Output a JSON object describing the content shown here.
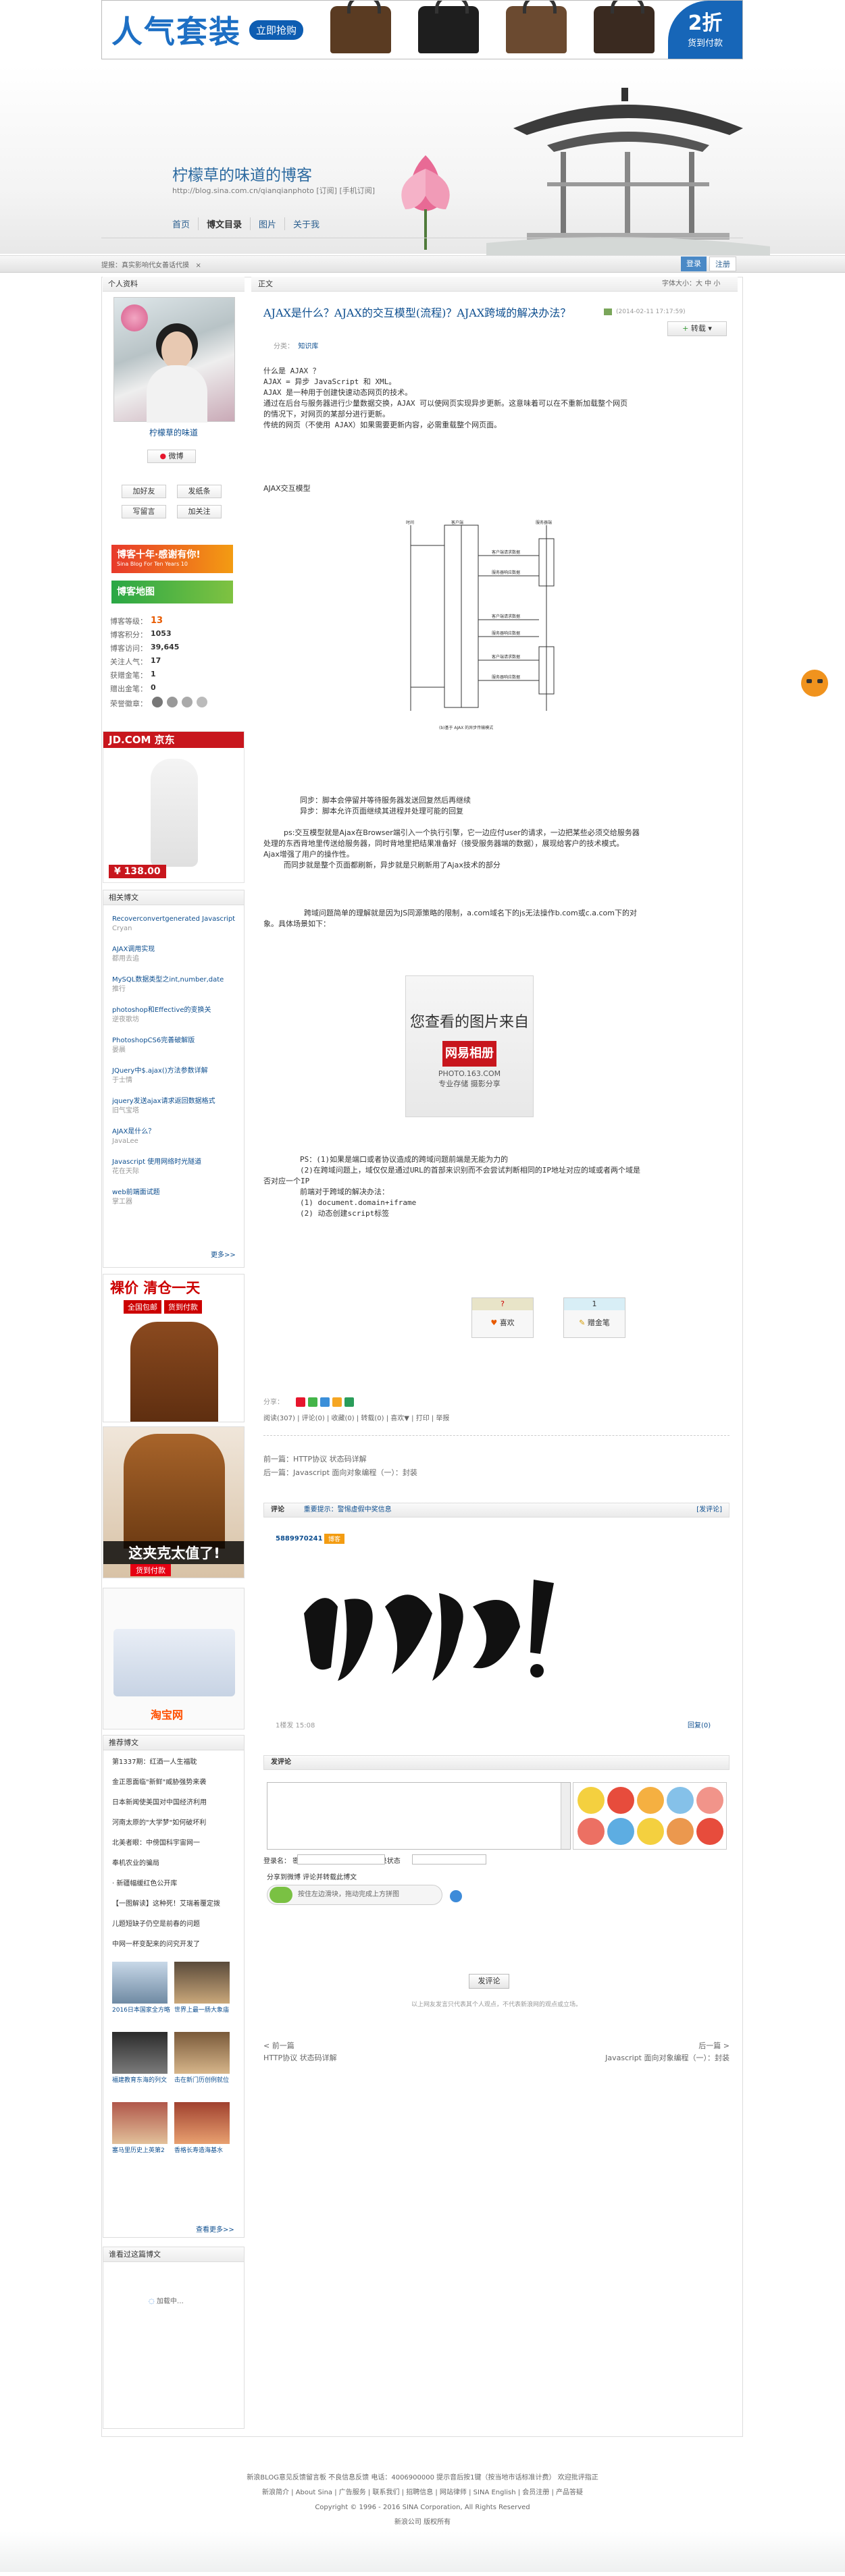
{
  "top_ad": {
    "title": "人气套装",
    "button": "立即抢购",
    "discount": "2折",
    "discount_sub": "货到付款"
  },
  "header": {
    "blog_title": "柠檬草的味道的博客",
    "blog_url": "http://blog.sina.com.cn/qianqianphoto",
    "url_extra": "[订阅] [手机订阅]"
  },
  "nav": [
    "首页",
    "博文目录",
    "图片",
    "关于我"
  ],
  "notice": {
    "text": "提报：真实影响代女善话代摸",
    "close": "×"
  },
  "login": {
    "login": "登录",
    "register": "注册"
  },
  "sidebar": {
    "profile_head": "个人资料",
    "username": "柠檬草的味道",
    "weibo": "微博",
    "buttons": [
      "加好友",
      "发纸条",
      "写留言",
      "加关注"
    ],
    "badge1": "博客十年·感谢有你!",
    "badge1_sub": "Sina Blog For Ten Years 10",
    "badge2": "博客地图",
    "stats": [
      {
        "label": "博客等级：",
        "value": "13"
      },
      {
        "label": "博客积分：",
        "value": "1053"
      },
      {
        "label": "博客访问：",
        "value": "39,645"
      },
      {
        "label": "关注人气：",
        "value": "17"
      },
      {
        "label": "获赠金笔：",
        "value": "1"
      },
      {
        "label": "赠出金笔：",
        "value": "0"
      },
      {
        "label": "荣誉徽章：",
        "value": ""
      }
    ],
    "jd": {
      "brand": "JD.COM 京东",
      "price": "¥ 138.00"
    },
    "related_head": "相关博文",
    "related": [
      {
        "title": "Recoverconvertgenerated Javascript",
        "author": "Cryan"
      },
      {
        "title": "AJAX调用实现",
        "author": "都用去追"
      },
      {
        "title": "MySQL数据类型之int,number,date",
        "author": "推行"
      },
      {
        "title": "photoshop和Effective的变换关",
        "author": "逆夜歌坊"
      },
      {
        "title": "PhotoshopCS6完善破解版",
        "author": "晏晨"
      },
      {
        "title": "JQuery中$.ajax()方法参数详解",
        "author": "于士情"
      },
      {
        "title": "jquery发送ajax请求返回数据格式",
        "author": "旧气宝塔"
      },
      {
        "title": "AJAX是什么？",
        "author": "JavaLee"
      },
      {
        "title": "Javascript 使用网络时光隧道",
        "author": "花在天际"
      },
      {
        "title": "web前端面试题",
        "author": "掌工器"
      }
    ],
    "related_more": "更多>>",
    "ad1": {
      "title": "裸价 清仓一天",
      "tag1": "全国包邮",
      "tag2": "货到付款"
    },
    "ad2": {
      "title": "这夹克太值了!",
      "tag": "货到付款"
    },
    "ad3": {
      "logo": "淘宝网"
    },
    "recent_head": "推荐博文",
    "recent": [
      "第1337期：红酒一人生福耽",
      "金正恩面临\"新鲜\"威胁强势来袭",
      "日本新闻使美国对中国经济利用",
      "河南太原的\"大学梦\"如何破坏利",
      "北美者眼：中傍国科宇宙网一",
      "奉机农业的骗局",
      "· 新疆幅缓红色公开库",
      "【一图解读】这种死！艾瑞着覆定拨",
      "儿题短缺子仍空是前春的问题",
      "中网一杯变配来的问究开发了"
    ],
    "thumbs": [
      {
        "caption": "2016日本国家全方略"
      },
      {
        "caption": "世界上最一肠大象庙"
      },
      {
        "caption": "福建教育东海的列文"
      },
      {
        "caption": "击在新门历创例就位"
      },
      {
        "caption": "塞马里历史上英第2"
      },
      {
        "caption": "香格长寿造海基水"
      }
    ],
    "recent_more": "查看更多>>",
    "visitors_head": "谁看过这篇博文",
    "visitors_loading": "加载中…"
  },
  "article": {
    "crumb": "正文",
    "crumb_right": "字体大小：大 中 小",
    "title": "AJAX是什么？AJAX的交互模型(流程)？AJAX跨域的解决办法？",
    "date": "(2014-02-11 17:17:59)",
    "repost": "转载",
    "category_label": "分类：",
    "category": "知识库",
    "para1": [
      "什么是 AJAX ？",
      "AJAX = 异步 JavaScript 和 XML。",
      "AJAX 是一种用于创建快速动态网页的技术。",
      "通过在后台与服务器进行少量数据交换，AJAX 可以使网页实现异步更新。这意味着可以在不重新加载整个网页",
      "的情况下，对网页的某部分进行更新。",
      "传统的网页（不使用 AJAX）如果需要更新内容，必需重载整个网页面。"
    ],
    "section": "AJAX交互模型",
    "diagram_caption": "(b)基于 AJAX 的异步传输模式",
    "para2": [
      "同步：脚本会停留并等待服务器发送回复然后再继续",
      "异步：脚本允许页面继续其进程并处理可能的回复",
      "ps:交互模型就是Ajax在Browser端引入一个执行引擎，它一边应付user的请求，一边把某些必须交给服务器",
      "处理的东西背地里传送给服务器，同时背地里把结果准备好（接受服务器端的数据），展现给客户的技术模式。",
      "Ajax增强了用户的操作性。",
      "而同步就是整个页面都刷新，异步就是只刷新用了Ajax技术的部分"
    ],
    "para3": [
      "跨域问题简单的理解就是因为JS同源策略的限制，a.com域名下的js无法操作b.com或c.a.com下的对",
      "象。具体场景如下："
    ],
    "image_note": {
      "title": "您查看的图片来自",
      "logo": "网易相册",
      "sub": "PHOTO.163.COM",
      "slogan": "专业存储 摄影分享"
    },
    "para4": [
      "PS：(1)如果是端口或者协议造成的跨域问题前端是无能为力的",
      "(2)在跨域问题上，域仅仅是通过URL的首部来识别而不会尝试判断相同的IP地址对应的域或者两个域是",
      "否对应一个IP",
      "前端对于跨域的解决办法：",
      "(1) document.domain+iframe",
      "(2) 动态创建script标签"
    ],
    "votes": [
      {
        "count": "?",
        "label": "喜欢"
      },
      {
        "count": "1",
        "label": "赠金笔"
      }
    ],
    "share_label": "分享：",
    "actions": "阅读(307) | 评论(0) | 收藏(0) | 转载(0) | 喜欢▼ | 打印 | 举报",
    "prev": "前一篇：HTTP协议  状态码详解",
    "next": "后一篇：Javascript 面向对象编程（一）：封装",
    "comment_head": "评论",
    "comment_note": "重要提示：警惕虚假中奖信息",
    "comment_right": "[发评论]",
    "commenter": "5889970241",
    "commenter_badge": "博客",
    "comment_date": "1楼发   15:08",
    "comment_reply": "回复(0)",
    "post_head": "发评论",
    "login_row": "登录名：                              密码：                       找回密码  注册    记住登录状态",
    "check_row": "分享到微博      评论并转载此博文",
    "slider": "按住左边滑块，拖动完成上方拼图",
    "submit": "发评论",
    "disclaimer": "以上网友发言只代表其个人观点，不代表新浪网的观点或立场。",
    "bottom_prev_label": "< 前一篇",
    "bottom_prev": "HTTP协议  状态码详解",
    "bottom_next_label": "后一篇 >",
    "bottom_next": "Javascript 面向对象编程（一）：封装"
  },
  "footer": {
    "line1": "新浪BLOG意见反馈留言板  不良信息反馈  电话：4006900000 提示音后按1键（按当地市话标准计费）  欢迎批评指正",
    "line2": "新浪简介 | About Sina | 广告服务 | 联系我们 | 招聘信息 | 网站律师 | SINA English | 会员注册 | 产品答疑",
    "line3": "Copyright © 1996 - 2016 SINA Corporation, All Rights Reserved",
    "line4": "新浪公司 版权所有"
  }
}
